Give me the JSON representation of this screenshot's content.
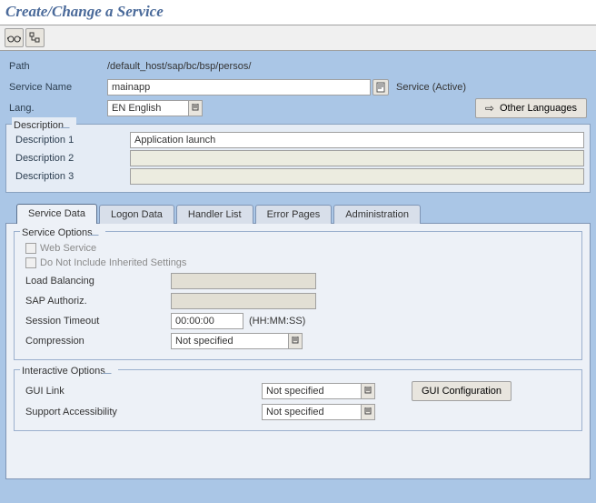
{
  "title": "Create/Change a Service",
  "fields": {
    "path_label": "Path",
    "path_value": "/default_host/sap/bc/bsp/persos/",
    "service_name_label": "Service Name",
    "service_name_value": "mainapp",
    "service_status": "Service (Active)",
    "lang_label": "Lang.",
    "lang_value": "EN English",
    "other_languages": "Other Languages"
  },
  "description": {
    "legend": "Description",
    "d1_label": "Description 1",
    "d1_value": "Application launch",
    "d2_label": "Description 2",
    "d2_value": "",
    "d3_label": "Description 3",
    "d3_value": ""
  },
  "tabs": {
    "service_data": "Service Data",
    "logon_data": "Logon Data",
    "handler_list": "Handler List",
    "error_pages": "Error Pages",
    "administration": "Administration"
  },
  "service_options": {
    "legend": "Service Options",
    "web_service": "Web Service",
    "do_not_include": "Do Not Include Inherited Settings",
    "load_balancing": "Load Balancing",
    "load_balancing_value": "",
    "sap_authoriz": "SAP Authoriz.",
    "sap_authoriz_value": "",
    "session_timeout": "Session Timeout",
    "session_timeout_value": "00:00:00",
    "session_timeout_hint": "(HH:MM:SS)",
    "compression": "Compression",
    "compression_value": "Not specified"
  },
  "interactive_options": {
    "legend": "Interactive Options",
    "gui_link": "GUI Link",
    "gui_link_value": "Not specified",
    "support_accessibility": "Support Accessibility",
    "support_accessibility_value": "Not specified",
    "gui_configuration": "GUI Configuration"
  }
}
